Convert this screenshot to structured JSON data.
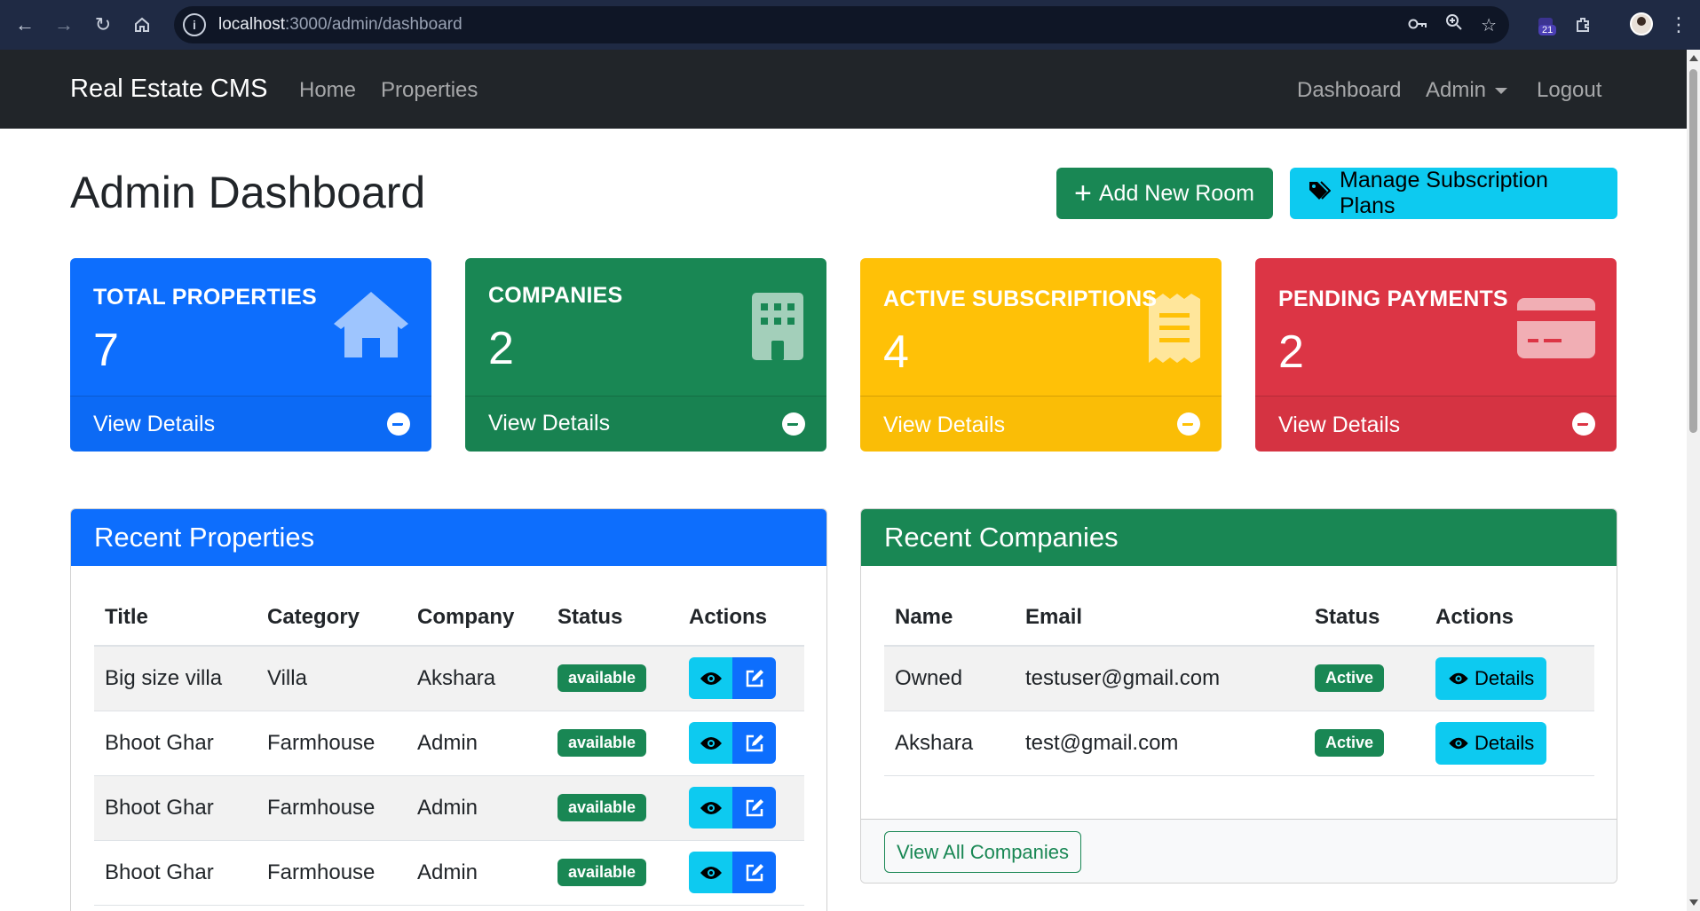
{
  "browser": {
    "url_host": "localhost",
    "url_path": ":3000/admin/dashboard",
    "extension_badge": "21"
  },
  "navbar": {
    "brand": "Real Estate CMS",
    "left_links": [
      "Home",
      "Properties"
    ],
    "right_links": {
      "dashboard": "Dashboard",
      "admin": "Admin",
      "logout": "Logout"
    }
  },
  "page": {
    "title": "Admin Dashboard",
    "add_room_label": "Add New Room",
    "manage_plans_label": "Manage Subscription Plans"
  },
  "stats": [
    {
      "title": "TOTAL PROPERTIES",
      "value": "7",
      "link": "View Details",
      "icon": "house-icon",
      "color": "#0d6efd"
    },
    {
      "title": "COMPANIES",
      "value": "2",
      "link": "View Details",
      "icon": "building-icon",
      "color": "#198754"
    },
    {
      "title": "ACTIVE SUBSCRIPTIONS",
      "value": "4",
      "link": "View Details",
      "icon": "receipt-icon",
      "color": "#ffc107"
    },
    {
      "title": "PENDING PAYMENTS",
      "value": "2",
      "link": "View Details",
      "icon": "credit-card-icon",
      "color": "#dc3545"
    }
  ],
  "recent_properties": {
    "title": "Recent Properties",
    "headers": [
      "Title",
      "Category",
      "Company",
      "Status",
      "Actions"
    ],
    "rows": [
      {
        "title": "Big size villa",
        "category": "Villa",
        "company": "Akshara",
        "status": "available"
      },
      {
        "title": "Bhoot Ghar",
        "category": "Farmhouse",
        "company": "Admin",
        "status": "available"
      },
      {
        "title": "Bhoot Ghar",
        "category": "Farmhouse",
        "company": "Admin",
        "status": "available"
      },
      {
        "title": "Bhoot Ghar",
        "category": "Farmhouse",
        "company": "Admin",
        "status": "available"
      }
    ]
  },
  "recent_companies": {
    "title": "Recent Companies",
    "headers": [
      "Name",
      "Email",
      "Status",
      "Actions"
    ],
    "rows": [
      {
        "name": "Owned",
        "email": "testuser@gmail.com",
        "status": "Active",
        "action": "Details"
      },
      {
        "name": "Akshara",
        "email": "test@gmail.com",
        "status": "Active",
        "action": "Details"
      }
    ],
    "footer_button": "View All Companies"
  }
}
